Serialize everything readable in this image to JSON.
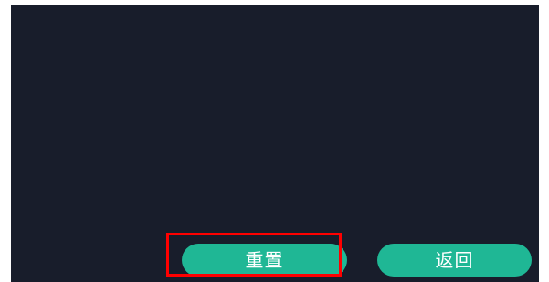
{
  "buttons": {
    "reset_label": "重置",
    "back_label": "返回"
  },
  "colors": {
    "panel_background": "#181d2b",
    "button_background": "#1fb795",
    "button_text": "#ffffff",
    "highlight_border": "#ff0000"
  }
}
